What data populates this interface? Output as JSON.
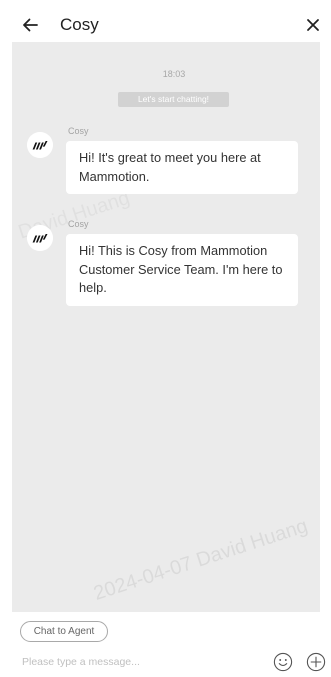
{
  "header": {
    "back_icon": "arrow-left-icon",
    "title": "Cosy",
    "close_icon": "close-icon"
  },
  "chat": {
    "timestamp": "18:03",
    "system_notice": "Let's start chatting!",
    "messages": [
      {
        "sender": "Cosy",
        "avatar_icon": "mammotion-logo-icon",
        "text": "Hi! It's great to meet you here at Mammotion."
      },
      {
        "sender": "Cosy",
        "avatar_icon": "mammotion-logo-icon",
        "text": "Hi! This is Cosy from Mammotion Customer Service Team. I'm here to help."
      }
    ]
  },
  "watermark": "2024-04-07 David Huang",
  "composer": {
    "agent_button_label": "Chat to Agent",
    "input_placeholder": "Please type a message...",
    "input_value": "",
    "emoji_icon": "smiley-icon",
    "attach_icon": "plus-circle-icon"
  },
  "colors": {
    "chat_background": "#ebebeb",
    "bubble": "#ffffff",
    "notice_background": "#d2d2d2",
    "text": "#333333",
    "sender_name": "#a3a3a3"
  }
}
